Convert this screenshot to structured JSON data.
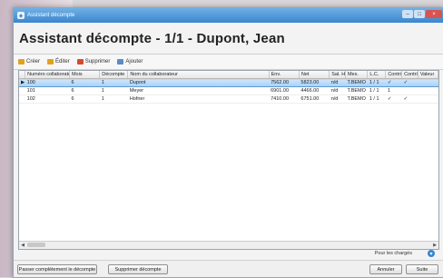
{
  "window": {
    "title": "Assistant décompte",
    "minimize": "–",
    "maximize": "□",
    "close": "×"
  },
  "heading": "Assistant décompte - 1/1 - Dupont, Jean",
  "toolbar": [
    {
      "label": "Créer",
      "color": "#e0a21a"
    },
    {
      "label": "Éditer",
      "color": "#e0a21a"
    },
    {
      "label": "Supprimer",
      "color": "#d64a2e"
    },
    {
      "label": "Ajouter",
      "color": "#5b8ac7"
    }
  ],
  "table": {
    "columns": [
      "",
      "Numéro collaborateur",
      "Mois",
      "Décompte",
      "Nom du collaborateur",
      "Env.",
      "Net",
      "Sal. Heures",
      "Mes.",
      "L.C.",
      "Contrôlé",
      "Contrôlé",
      "Valeur"
    ],
    "rows": [
      [
        "▶",
        "100",
        "6",
        "1",
        "Dupont",
        "7562.00",
        "5823.00",
        "n/d",
        "T.BEMO",
        "1 / 1",
        "✓",
        "✓",
        ""
      ],
      [
        "",
        "101",
        "6",
        "1",
        "Meyer",
        "6901.00",
        "4466.00",
        "n/d",
        "T.BEMO",
        "1 / 1",
        "1",
        "",
        ""
      ],
      [
        "",
        "102",
        "6",
        "1",
        "Hofner",
        "7410.00",
        "6751.00",
        "n/d",
        "T.BEMO",
        "1 / 1",
        "✓",
        "✓",
        ""
      ]
    ]
  },
  "filter": {
    "text": "Pour les chargés",
    "icon": "filter-icon"
  },
  "footer": {
    "left_button": "Passer complètement le décompte",
    "mid_button": "Supprimer décompte",
    "cancel_button": "Annuler",
    "next_button": "Suite"
  }
}
